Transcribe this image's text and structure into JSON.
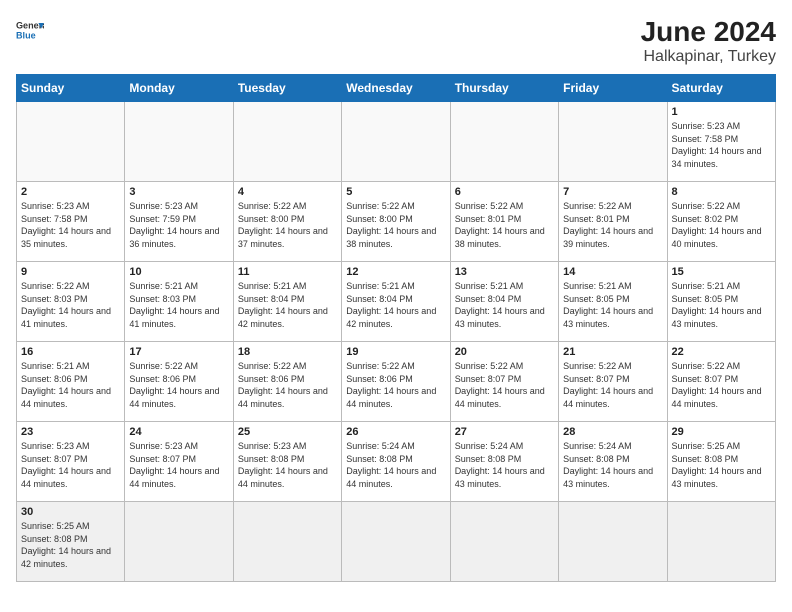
{
  "header": {
    "logo_line1": "General",
    "logo_line2": "Blue",
    "title": "June 2024",
    "subtitle": "Halkapinar, Turkey"
  },
  "weekdays": [
    "Sunday",
    "Monday",
    "Tuesday",
    "Wednesday",
    "Thursday",
    "Friday",
    "Saturday"
  ],
  "weeks": [
    [
      {
        "day": "",
        "info": ""
      },
      {
        "day": "",
        "info": ""
      },
      {
        "day": "",
        "info": ""
      },
      {
        "day": "",
        "info": ""
      },
      {
        "day": "",
        "info": ""
      },
      {
        "day": "",
        "info": ""
      },
      {
        "day": "1",
        "info": "Sunrise: 5:23 AM\nSunset: 7:58 PM\nDaylight: 14 hours\nand 34 minutes."
      }
    ],
    [
      {
        "day": "2",
        "info": "Sunrise: 5:23 AM\nSunset: 7:58 PM\nDaylight: 14 hours\nand 35 minutes."
      },
      {
        "day": "3",
        "info": "Sunrise: 5:23 AM\nSunset: 7:59 PM\nDaylight: 14 hours\nand 36 minutes."
      },
      {
        "day": "4",
        "info": "Sunrise: 5:22 AM\nSunset: 8:00 PM\nDaylight: 14 hours\nand 37 minutes."
      },
      {
        "day": "5",
        "info": "Sunrise: 5:22 AM\nSunset: 8:00 PM\nDaylight: 14 hours\nand 38 minutes."
      },
      {
        "day": "6",
        "info": "Sunrise: 5:22 AM\nSunset: 8:01 PM\nDaylight: 14 hours\nand 38 minutes."
      },
      {
        "day": "7",
        "info": "Sunrise: 5:22 AM\nSunset: 8:01 PM\nDaylight: 14 hours\nand 39 minutes."
      },
      {
        "day": "8",
        "info": "Sunrise: 5:22 AM\nSunset: 8:02 PM\nDaylight: 14 hours\nand 40 minutes."
      }
    ],
    [
      {
        "day": "9",
        "info": "Sunrise: 5:22 AM\nSunset: 8:03 PM\nDaylight: 14 hours\nand 41 minutes."
      },
      {
        "day": "10",
        "info": "Sunrise: 5:21 AM\nSunset: 8:03 PM\nDaylight: 14 hours\nand 41 minutes."
      },
      {
        "day": "11",
        "info": "Sunrise: 5:21 AM\nSunset: 8:04 PM\nDaylight: 14 hours\nand 42 minutes."
      },
      {
        "day": "12",
        "info": "Sunrise: 5:21 AM\nSunset: 8:04 PM\nDaylight: 14 hours\nand 42 minutes."
      },
      {
        "day": "13",
        "info": "Sunrise: 5:21 AM\nSunset: 8:04 PM\nDaylight: 14 hours\nand 43 minutes."
      },
      {
        "day": "14",
        "info": "Sunrise: 5:21 AM\nSunset: 8:05 PM\nDaylight: 14 hours\nand 43 minutes."
      },
      {
        "day": "15",
        "info": "Sunrise: 5:21 AM\nSunset: 8:05 PM\nDaylight: 14 hours\nand 43 minutes."
      }
    ],
    [
      {
        "day": "16",
        "info": "Sunrise: 5:21 AM\nSunset: 8:06 PM\nDaylight: 14 hours\nand 44 minutes."
      },
      {
        "day": "17",
        "info": "Sunrise: 5:22 AM\nSunset: 8:06 PM\nDaylight: 14 hours\nand 44 minutes."
      },
      {
        "day": "18",
        "info": "Sunrise: 5:22 AM\nSunset: 8:06 PM\nDaylight: 14 hours\nand 44 minutes."
      },
      {
        "day": "19",
        "info": "Sunrise: 5:22 AM\nSunset: 8:06 PM\nDaylight: 14 hours\nand 44 minutes."
      },
      {
        "day": "20",
        "info": "Sunrise: 5:22 AM\nSunset: 8:07 PM\nDaylight: 14 hours\nand 44 minutes."
      },
      {
        "day": "21",
        "info": "Sunrise: 5:22 AM\nSunset: 8:07 PM\nDaylight: 14 hours\nand 44 minutes."
      },
      {
        "day": "22",
        "info": "Sunrise: 5:22 AM\nSunset: 8:07 PM\nDaylight: 14 hours\nand 44 minutes."
      }
    ],
    [
      {
        "day": "23",
        "info": "Sunrise: 5:23 AM\nSunset: 8:07 PM\nDaylight: 14 hours\nand 44 minutes."
      },
      {
        "day": "24",
        "info": "Sunrise: 5:23 AM\nSunset: 8:07 PM\nDaylight: 14 hours\nand 44 minutes."
      },
      {
        "day": "25",
        "info": "Sunrise: 5:23 AM\nSunset: 8:08 PM\nDaylight: 14 hours\nand 44 minutes."
      },
      {
        "day": "26",
        "info": "Sunrise: 5:24 AM\nSunset: 8:08 PM\nDaylight: 14 hours\nand 44 minutes."
      },
      {
        "day": "27",
        "info": "Sunrise: 5:24 AM\nSunset: 8:08 PM\nDaylight: 14 hours\nand 43 minutes."
      },
      {
        "day": "28",
        "info": "Sunrise: 5:24 AM\nSunset: 8:08 PM\nDaylight: 14 hours\nand 43 minutes."
      },
      {
        "day": "29",
        "info": "Sunrise: 5:25 AM\nSunset: 8:08 PM\nDaylight: 14 hours\nand 43 minutes."
      }
    ],
    [
      {
        "day": "30",
        "info": "Sunrise: 5:25 AM\nSunset: 8:08 PM\nDaylight: 14 hours\nand 42 minutes."
      },
      {
        "day": "",
        "info": ""
      },
      {
        "day": "",
        "info": ""
      },
      {
        "day": "",
        "info": ""
      },
      {
        "day": "",
        "info": ""
      },
      {
        "day": "",
        "info": ""
      },
      {
        "day": "",
        "info": ""
      }
    ]
  ]
}
